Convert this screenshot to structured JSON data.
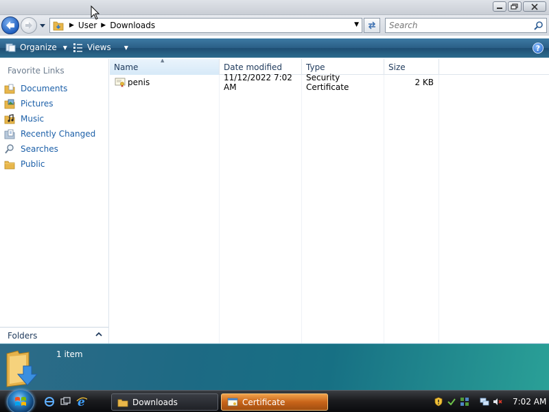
{
  "window": {
    "minimize_symbol": "—",
    "maximize_symbol": "❐",
    "close_symbol": "✕"
  },
  "address": {
    "breadcrumb": [
      "User",
      "Downloads"
    ],
    "search_placeholder": "Search"
  },
  "commandbar": {
    "organize_label": "Organize",
    "views_label": "Views",
    "help_label": "?"
  },
  "navpane": {
    "heading": "Favorite Links",
    "items": [
      {
        "label": "Documents",
        "icon": "documents-folder-icon"
      },
      {
        "label": "Pictures",
        "icon": "pictures-folder-icon"
      },
      {
        "label": "Music",
        "icon": "music-folder-icon"
      },
      {
        "label": "Recently Changed",
        "icon": "recently-changed-icon"
      },
      {
        "label": "Searches",
        "icon": "search-icon"
      },
      {
        "label": "Public",
        "icon": "public-folder-icon"
      }
    ],
    "folders_label": "Folders"
  },
  "listview": {
    "columns": [
      "Name",
      "Date modified",
      "Type",
      "Size"
    ],
    "files": [
      {
        "name": "penis",
        "date_modified": "11/12/2022 7:02 AM",
        "type": "Security Certificate",
        "size": "2 KB",
        "icon": "certificate-file-icon"
      }
    ]
  },
  "details": {
    "item_count": "1 item"
  },
  "taskbar": {
    "buttons": [
      {
        "label": "Downloads",
        "icon": "folder-icon",
        "active": false
      },
      {
        "label": "Certificate",
        "icon": "certificate-window-icon",
        "active": true
      }
    ],
    "clock": "7:02 AM"
  },
  "colors": {
    "accent": "#1b5fa8",
    "commandbar": "#2a5e86",
    "details_pane": "#1d6a84",
    "active_task": "#c8641a"
  }
}
